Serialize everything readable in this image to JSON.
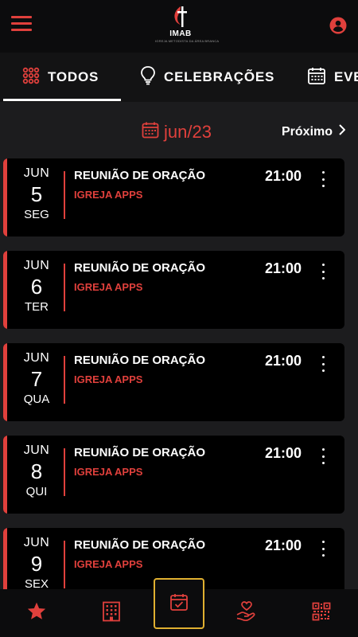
{
  "header": {
    "logo_name": "IMAB",
    "logo_sub": "IGREJA METODISTA DA ÁREA BRANCA",
    "menu_icon": "hamburger-menu-icon",
    "user_icon": "user-account-icon"
  },
  "tabs": [
    {
      "label": "TODOS",
      "icon": "grid-dots-icon",
      "active": true
    },
    {
      "label": "CELEBRAÇÕES",
      "icon": "lightbulb-icon",
      "active": false
    },
    {
      "label": "EVENTOS",
      "icon": "calendar-icon",
      "active": false
    }
  ],
  "month_nav": {
    "current": "jun/23",
    "next_label": "Próximo"
  },
  "events": [
    {
      "month": "JUN",
      "day": "5",
      "weekday": "SEG",
      "title": "REUNIÃO DE ORAÇÃO",
      "subtitle": "IGREJA APPS",
      "time": "21:00"
    },
    {
      "month": "JUN",
      "day": "6",
      "weekday": "TER",
      "title": "REUNIÃO DE ORAÇÃO",
      "subtitle": "IGREJA APPS",
      "time": "21:00"
    },
    {
      "month": "JUN",
      "day": "7",
      "weekday": "QUA",
      "title": "REUNIÃO DE ORAÇÃO",
      "subtitle": "IGREJA APPS",
      "time": "21:00"
    },
    {
      "month": "JUN",
      "day": "8",
      "weekday": "QUI",
      "title": "REUNIÃO DE ORAÇÃO",
      "subtitle": "IGREJA APPS",
      "time": "21:00"
    },
    {
      "month": "JUN",
      "day": "9",
      "weekday": "SEX",
      "title": "REUNIÃO DE ORAÇÃO",
      "subtitle": "IGREJA APPS",
      "time": "21:00"
    }
  ],
  "bottom_nav": [
    {
      "icon": "star-icon",
      "active": false
    },
    {
      "icon": "building-icon",
      "active": false
    },
    {
      "icon": "calendar-check-icon",
      "active": true
    },
    {
      "icon": "hand-heart-icon",
      "active": false
    },
    {
      "icon": "qr-code-icon",
      "active": false
    }
  ],
  "colors": {
    "accent": "#e0403c",
    "background": "#1c1c1e",
    "card": "#000000",
    "active_nav_border": "#e0b030"
  }
}
